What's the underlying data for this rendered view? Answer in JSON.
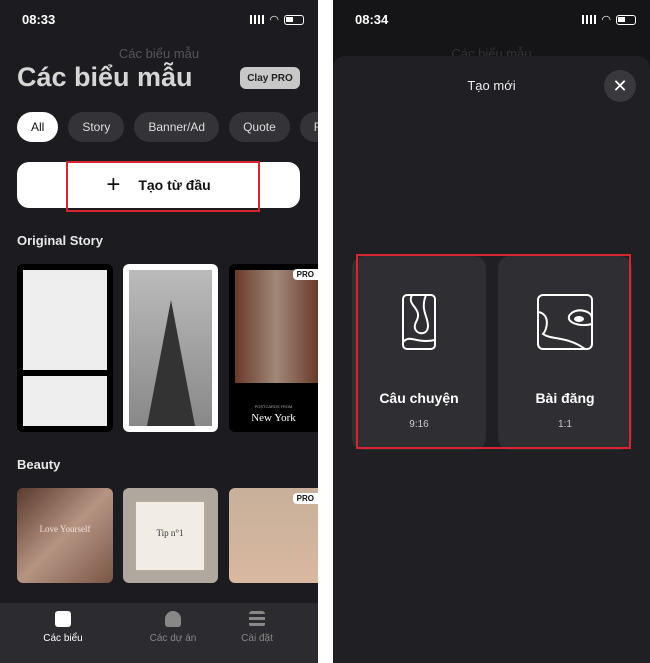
{
  "left": {
    "status": {
      "time": "08:33"
    },
    "ghost_title": "Các biểu mẫu",
    "title": "Các biểu mẫu",
    "pro_button": "Clay PRO",
    "chips": [
      "All",
      "Story",
      "Banner/Ad",
      "Quote",
      "F"
    ],
    "create_button": "Tạo từ đầu",
    "sections": [
      {
        "title": "Original Story",
        "thumbs": [
          {
            "pro": false
          },
          {
            "pro": false
          },
          {
            "pro": true,
            "caption_small": "POSTCARDS FROM",
            "caption": "New York"
          }
        ]
      },
      {
        "title": "Beauty",
        "thumbs": [
          {
            "pro": false,
            "caption": "Love Yourself"
          },
          {
            "pro": false,
            "caption": "Tip n°1"
          },
          {
            "pro": true
          }
        ]
      }
    ],
    "pro_badge": "PRO",
    "nav": [
      {
        "label": "Các biểu",
        "icon": "templates-icon",
        "active": true
      },
      {
        "label": "Các dự án",
        "icon": "user-icon",
        "active": false
      },
      {
        "label": "Cài đặt",
        "icon": "settings-icon",
        "active": false
      }
    ]
  },
  "right": {
    "status": {
      "time": "08:34"
    },
    "ghost_title": "Các biểu mẫu",
    "sheet_title": "Tạo mới",
    "options": [
      {
        "label": "Câu chuyện",
        "ratio": "9:16",
        "icon": "story-icon"
      },
      {
        "label": "Bài đăng",
        "ratio": "1:1",
        "icon": "post-icon"
      }
    ]
  },
  "colors": {
    "background": "#1b1b20",
    "highlight": "#d7262e",
    "card": "#2e2e33"
  }
}
